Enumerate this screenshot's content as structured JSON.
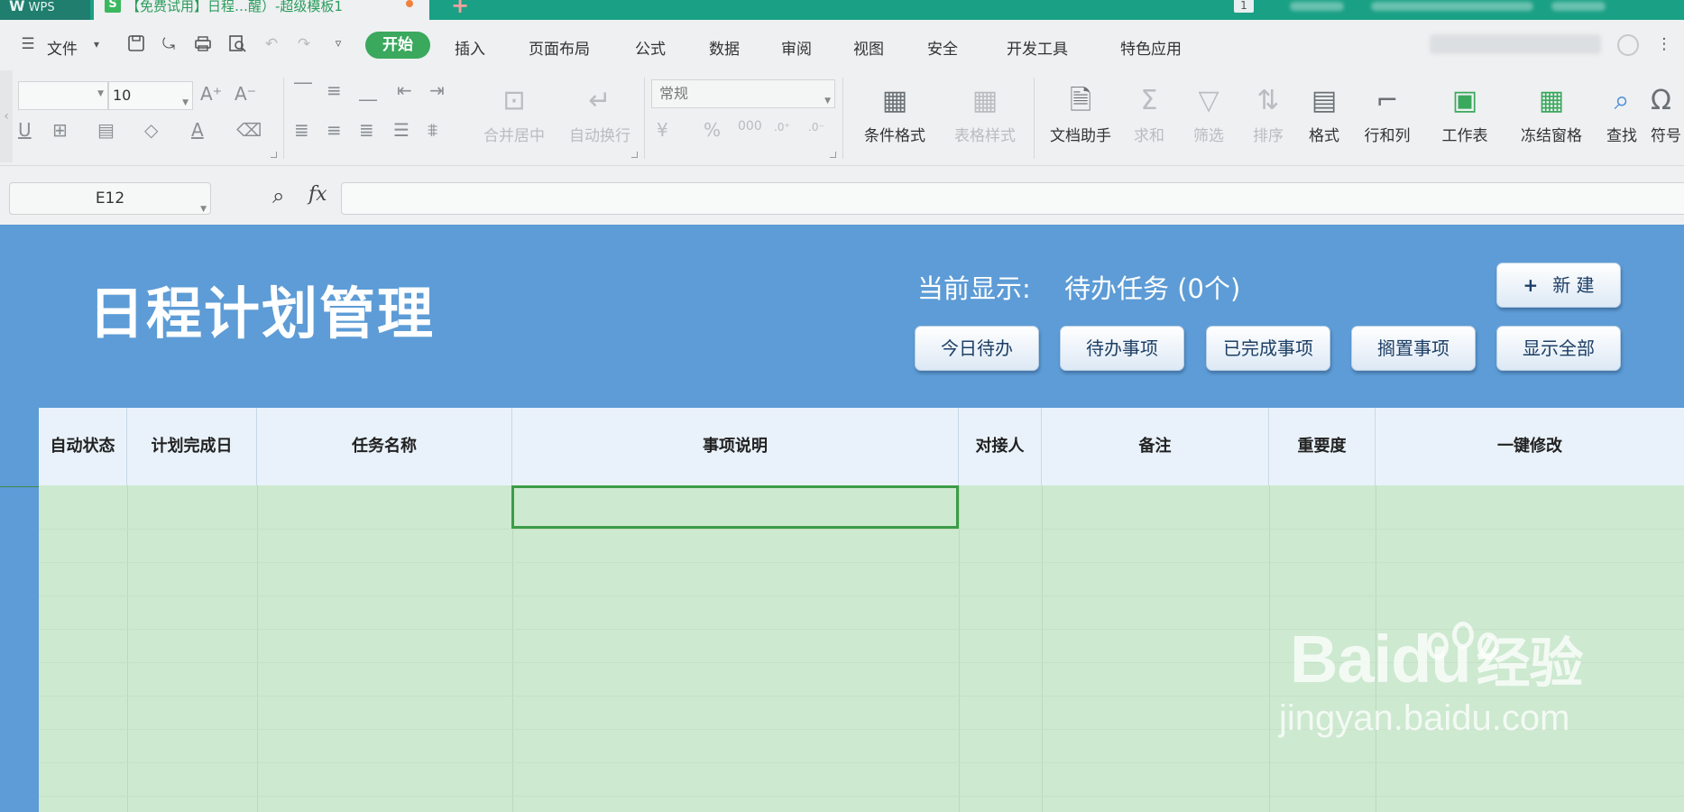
{
  "tabs": {
    "app_tab": "WPS",
    "doc_tab": "【免费试用】日程…醒）-超级模板1",
    "new_tab": "+",
    "window_count": "1"
  },
  "menu": {
    "file": "文件",
    "items": [
      "开始",
      "插入",
      "页面布局",
      "公式",
      "数据",
      "审阅",
      "视图",
      "安全",
      "开发工具",
      "特色应用"
    ]
  },
  "ribbon": {
    "font_size": "10",
    "number_format": "常规",
    "merge_center": "合并居中",
    "wrap_text": "自动换行",
    "conditional_format": "条件格式",
    "table_style": "表格样式",
    "doc_assistant": "文档助手",
    "sum": "求和",
    "filter": "筛选",
    "sort": "排序",
    "format": "格式",
    "row_col": "行和列",
    "worksheet": "工作表",
    "freeze": "冻结窗格",
    "find": "查找",
    "symbol": "符号"
  },
  "formula_bar": {
    "cell_ref": "E12",
    "fx": "fx",
    "formula": ""
  },
  "sheet": {
    "title": "日程计划管理",
    "current_label": "当前显示:",
    "current_value": "待办任务 (0个)",
    "new_button": "新 建",
    "filters": [
      "今日待办",
      "待办事项",
      "已完成事项",
      "搁置事项",
      "显示全部"
    ],
    "columns": [
      "自动状态",
      "计划完成日",
      "任务名称",
      "事项说明",
      "对接人",
      "备注",
      "重要度",
      "一键修改"
    ]
  },
  "watermark": {
    "brand": "Bai",
    "brand2": "du",
    "cn": "经验",
    "url": "jingyan.baidu.com"
  },
  "colors": {
    "tab_bar": "#1aa085",
    "accent_green": "#3aa85d",
    "sheet_header_bg": "#5d9cd6",
    "table_body": "#cde9d0",
    "selection": "#3d9c47"
  }
}
